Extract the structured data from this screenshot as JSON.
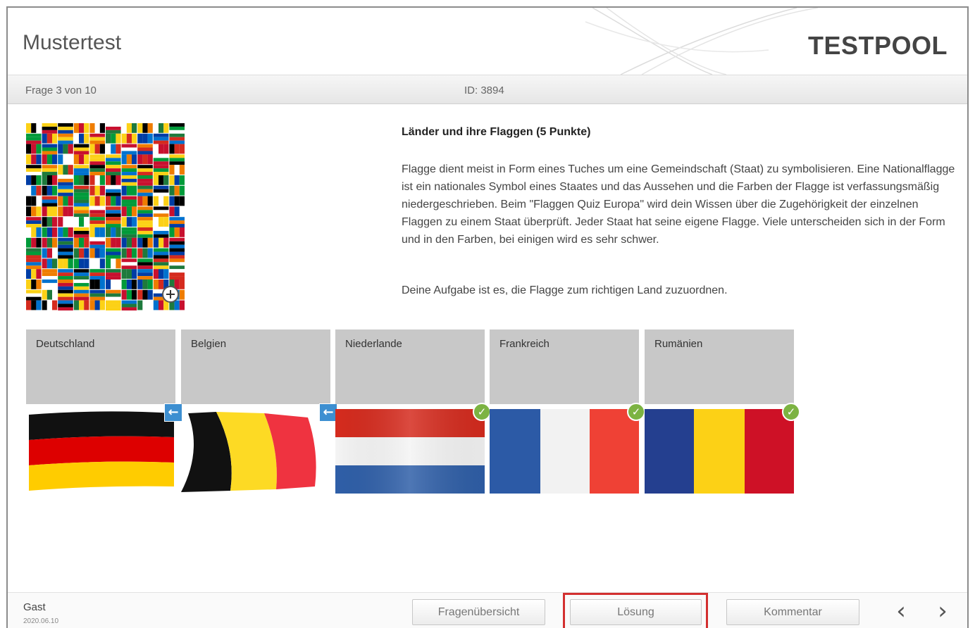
{
  "header": {
    "title": "Mustertest",
    "brand": "TESTPOOL"
  },
  "infobar": {
    "counter": "Frage 3 von 10",
    "id": "ID: 3894"
  },
  "question": {
    "title": "Länder und ihre Flaggen (5 Punkte)",
    "paragraph": "Flagge dient meist in Form eines Tuches um eine Gemeindschaft (Staat) zu symbolisieren. Eine Nationalflagge ist ein nationales Symbol eines Staates und das Aussehen und die Farben der Flagge ist verfassungsmäßig niedergeschrieben. Beim \"Flaggen Quiz Europa\" wird dein Wissen über die Zugehörigkeit der einzelnen Flaggen zu einem Staat überprüft. Jeder Staat hat seine eigene Flagge. Viele unterscheiden sich in der Form und in den Farben, bei einigen wird es sehr schwer.",
    "task": "Deine Aufgabe ist es, die Flagge zum richtigen Land zuzuordnen.",
    "image_icon": "flag-mosaic",
    "zoom_icon": "zoom-in-icon"
  },
  "cards": [
    {
      "label": "Deutschland",
      "flag": "germany",
      "status": "return-arrow",
      "colors": [
        "#111111",
        "#dd0000",
        "#ffcc00"
      ]
    },
    {
      "label": "Belgien",
      "flag": "belgium",
      "status": "return-arrow",
      "colors": [
        "#111111",
        "#fdda24",
        "#ef3340"
      ]
    },
    {
      "label": "Niederlande",
      "flag": "netherlands",
      "status": "correct",
      "colors": [
        "#d52b1e",
        "#ffffff",
        "#1e4785"
      ]
    },
    {
      "label": "Frankreich",
      "flag": "france",
      "status": "correct",
      "colors": [
        "#0055a4",
        "#ffffff",
        "#ef4135"
      ]
    },
    {
      "label": "Rumänien",
      "flag": "romania",
      "status": "correct",
      "colors": [
        "#002b7f",
        "#fcd116",
        "#ce1126"
      ]
    }
  ],
  "footer": {
    "user": "Gast",
    "date": "2020.06.10",
    "overview_label": "Fragenübersicht",
    "solution_label": "Lösung",
    "comment_label": "Kommentar",
    "prev_icon": "‹",
    "next_icon": "›"
  },
  "colors": {
    "check": "#7cb342",
    "arrow": "#3d8fd1",
    "highlight": "#d32f2f"
  }
}
